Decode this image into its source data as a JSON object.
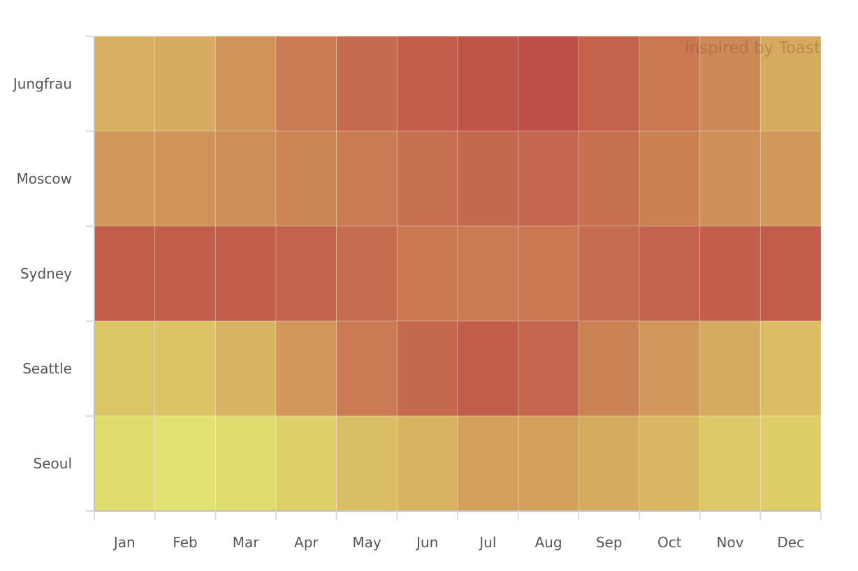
{
  "chart_data": {
    "type": "heatmap",
    "title": "",
    "xlabel": "",
    "ylabel": "",
    "credit": "Inspired by Toast",
    "categories": [
      "Jan",
      "Feb",
      "Mar",
      "Apr",
      "May",
      "Jun",
      "Jul",
      "Aug",
      "Sep",
      "Oct",
      "Nov",
      "Dec"
    ],
    "rows": [
      "Jungfrau",
      "Moscow",
      "Sydney",
      "Seattle",
      "Seoul"
    ],
    "value_scale": "relative intensity 0 (low) to 1 (high), estimated from cell color",
    "color_scale": {
      "low": "#E2E270",
      "high": "#BE5048"
    },
    "values": [
      [
        0.45,
        0.5,
        0.62,
        0.75,
        0.85,
        0.92,
        0.97,
        1.0,
        0.9,
        0.78,
        0.68,
        0.5
      ],
      [
        0.6,
        0.62,
        0.65,
        0.7,
        0.76,
        0.82,
        0.86,
        0.87,
        0.82,
        0.73,
        0.65,
        0.6
      ],
      [
        0.93,
        0.93,
        0.92,
        0.9,
        0.84,
        0.78,
        0.76,
        0.78,
        0.84,
        0.9,
        0.92,
        0.93
      ],
      [
        0.26,
        0.28,
        0.4,
        0.6,
        0.76,
        0.86,
        0.93,
        0.88,
        0.72,
        0.6,
        0.5,
        0.33
      ],
      [
        0.05,
        0.0,
        0.05,
        0.15,
        0.32,
        0.42,
        0.55,
        0.55,
        0.5,
        0.38,
        0.22,
        0.18
      ]
    ],
    "grid": false,
    "legend": "none"
  }
}
